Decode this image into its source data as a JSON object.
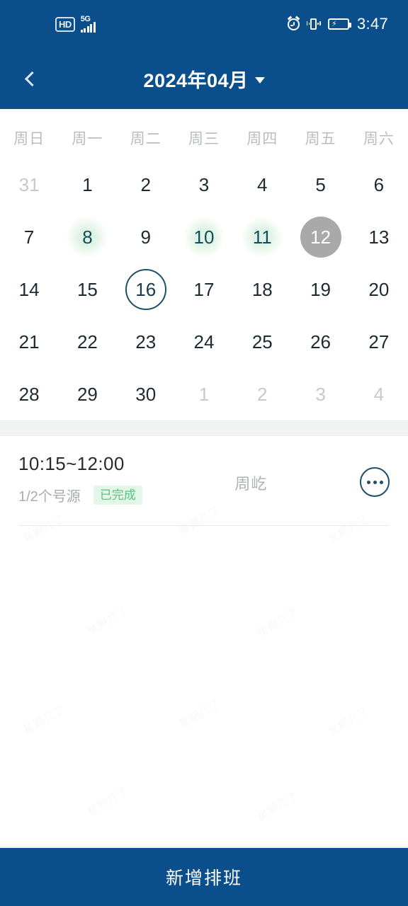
{
  "status_bar": {
    "hd_label": "HD",
    "network_label": "5G",
    "time": "3:47",
    "icons": [
      "hd-badge",
      "signal-bars",
      "alarm-icon",
      "vibrate-icon",
      "battery-charging-icon"
    ]
  },
  "nav": {
    "back_label": "返回",
    "title": "2024年04月",
    "dropdown_caret": "▼"
  },
  "calendar": {
    "weekdays": [
      "周日",
      "周一",
      "周二",
      "周三",
      "周四",
      "周五",
      "周六"
    ],
    "accent_green_bg": "#dff3e4",
    "accent_green_text": "#10505c",
    "today_bg": "#a9a9a9",
    "selected_border": "#1d4e6b",
    "muted_color": "#c6c9cd",
    "days": [
      {
        "label": "31",
        "state": "outside"
      },
      {
        "label": "1",
        "state": "normal"
      },
      {
        "label": "2",
        "state": "normal"
      },
      {
        "label": "3",
        "state": "normal"
      },
      {
        "label": "4",
        "state": "normal"
      },
      {
        "label": "5",
        "state": "normal"
      },
      {
        "label": "6",
        "state": "normal"
      },
      {
        "label": "7",
        "state": "normal"
      },
      {
        "label": "8",
        "state": "marked"
      },
      {
        "label": "9",
        "state": "normal"
      },
      {
        "label": "10",
        "state": "marked"
      },
      {
        "label": "11",
        "state": "marked"
      },
      {
        "label": "12",
        "state": "today"
      },
      {
        "label": "13",
        "state": "normal"
      },
      {
        "label": "14",
        "state": "normal"
      },
      {
        "label": "15",
        "state": "normal"
      },
      {
        "label": "16",
        "state": "selected"
      },
      {
        "label": "17",
        "state": "normal"
      },
      {
        "label": "18",
        "state": "normal"
      },
      {
        "label": "19",
        "state": "normal"
      },
      {
        "label": "20",
        "state": "normal"
      },
      {
        "label": "21",
        "state": "normal"
      },
      {
        "label": "22",
        "state": "normal"
      },
      {
        "label": "23",
        "state": "normal"
      },
      {
        "label": "24",
        "state": "normal"
      },
      {
        "label": "25",
        "state": "normal"
      },
      {
        "label": "26",
        "state": "normal"
      },
      {
        "label": "27",
        "state": "normal"
      },
      {
        "label": "28",
        "state": "normal"
      },
      {
        "label": "29",
        "state": "normal"
      },
      {
        "label": "30",
        "state": "normal"
      },
      {
        "label": "1",
        "state": "outside"
      },
      {
        "label": "2",
        "state": "outside"
      },
      {
        "label": "3",
        "state": "outside"
      },
      {
        "label": "4",
        "state": "outside"
      }
    ]
  },
  "shifts": [
    {
      "time_range": "10:15~12:00",
      "quota": "1/2个号源",
      "status_badge": "已完成",
      "badge_color": "#56c37f",
      "badge_bg": "#e3f7e9",
      "person": "周屹",
      "more_icon": "ellipsis-circle-icon"
    }
  ],
  "bottom_action": {
    "label": "新增排班",
    "background": "#0b4e8c"
  },
  "watermark": {
    "text": "星期几了"
  }
}
